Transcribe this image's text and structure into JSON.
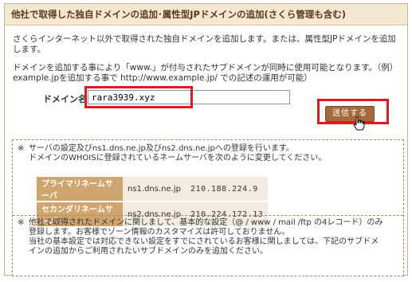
{
  "header": {
    "title": "他社で取得した独自ドメインの追加･属性型JPドメインの追加(さくら管理も含む)"
  },
  "intro": {
    "line1": "さくらインターネット以外で取得された独自ドメインを追加します。または、属性型JPドメインを追加します。",
    "line2a": "ドメインを追加する事により「www.」が付与されたサブドメインが同時に使用可能となります。（例）",
    "line2b": "example.jpを追加する事で http://www.example.jp/ での記述の運用が可能）"
  },
  "form": {
    "domain_label": "ドメイン名",
    "domain_value": "rara3939.xyz",
    "submit_label": "送信する"
  },
  "notice1": {
    "mark": "※",
    "line1": "サーバの設定及びns1.dns.ne.jp及びns2.dns.ne.jpへの登録を行います。",
    "line2": "ドメインのWHOISに登録されているネームサーバを次のように変更してください。"
  },
  "nameservers": [
    {
      "label": "プライマリネームサーバ",
      "host": "ns1.dns.ne.jp",
      "ip": "210.188.224.9"
    },
    {
      "label": "セカンダリネームサーバ",
      "host": "ns2.dns.ne.jp",
      "ip": "210.224.172.13"
    }
  ],
  "notice2": {
    "mark": "※",
    "line1": "他社で取得されたドメインに関しまして、基本的な設定（@ / www / mail /ftp の4レコード）のみ",
    "line2": "登録します。お客様でゾーン情報のカスタマイズは許可しておりません。",
    "line3": "当社の基本設定では対応できない設定をすでにされているお客様に関しましては、下記のサブドメ",
    "line4": "インの追加からご利用されたいサブドメインのみを追加ください。"
  },
  "colors": {
    "header_bg": "#f4e7d2",
    "highlight": "#e8141e",
    "button_bg": "#a56a3a",
    "table_header_bg": "#cfa56f"
  }
}
